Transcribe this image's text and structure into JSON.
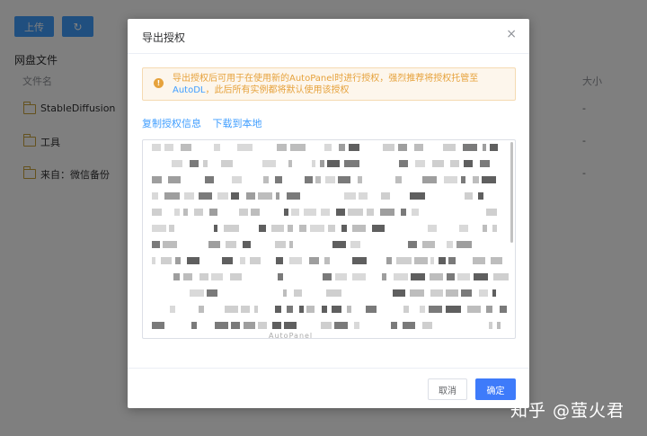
{
  "toolbar": {
    "upload_label": "上传",
    "refresh_glyph": "↻"
  },
  "files": {
    "section_title": "网盘文件",
    "col_name": "文件名",
    "col_size": "大小",
    "rows": [
      {
        "name": "StableDiffusion",
        "size": "-"
      },
      {
        "name": "工具",
        "size": "-"
      },
      {
        "name": "来自：微信备份",
        "size": "-"
      }
    ]
  },
  "dialog": {
    "title": "导出授权",
    "close_glyph": "×",
    "alert": {
      "icon": "!",
      "text_before": "导出授权后可用于在使用新的AutoPanel时进行授权，强烈推荐将授权托管至 ",
      "link_text": "AutoDL",
      "text_after": "，此后所有实例都将默认使用该授权"
    },
    "copy_link": "复制授权信息",
    "download_link": "下载到本地",
    "code_visible_fragment": "AutoPanel",
    "cancel_label": "取消",
    "ok_label": "确定"
  },
  "watermark": "知乎 @萤火君",
  "colors": {
    "primary": "#409eff",
    "warning": "#e6a23c",
    "warning_bg": "#fdf6ec",
    "folder": "#c9a33b"
  }
}
